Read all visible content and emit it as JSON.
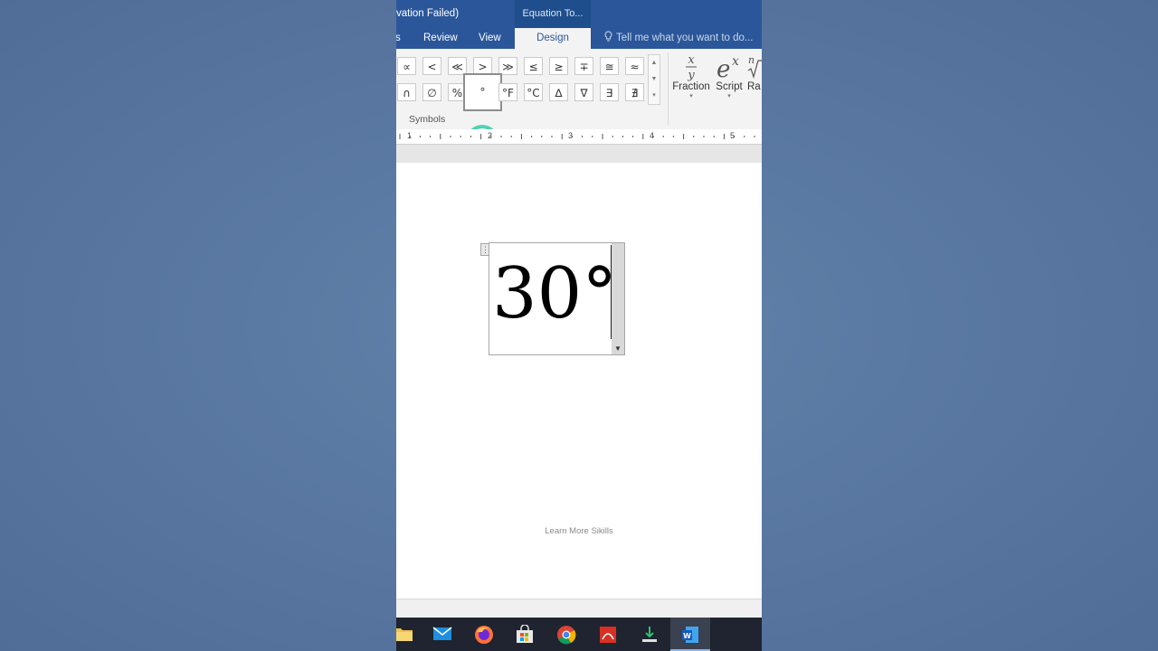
{
  "titlebar": {
    "title": "vation Failed)",
    "context_tab_label": "Equation To..."
  },
  "tabs": [
    {
      "label": "s",
      "active": false
    },
    {
      "label": "Review",
      "active": false
    },
    {
      "label": "View",
      "active": false
    },
    {
      "label": "Design",
      "active": true
    }
  ],
  "tell_me": {
    "placeholder": "Tell me what you want to do...",
    "icon": "lightbulb-icon"
  },
  "symbols_group": {
    "label": "Symbols",
    "row1": [
      "∝",
      "<",
      "≪",
      ">",
      "≫",
      "≤",
      "≥",
      "∓",
      "≅",
      "≈"
    ],
    "row2": [
      "∩",
      "∅",
      "%",
      "°",
      "°F",
      "°C",
      "∆",
      "∇",
      "∃",
      "∄"
    ],
    "selected_symbol": "°"
  },
  "structures": [
    {
      "label": "Fraction",
      "icon": "fraction-icon"
    },
    {
      "label": "Script",
      "icon": "script-icon"
    },
    {
      "label": "Ra",
      "icon": "radical-icon"
    }
  ],
  "ruler": {
    "numbers": [
      "1",
      "2",
      "3",
      "4",
      "5"
    ]
  },
  "equation": {
    "text": "30°"
  },
  "watermark": "Learn More Sikills",
  "taskbar": {
    "items": [
      {
        "name": "file-explorer",
        "active": false
      },
      {
        "name": "mail",
        "active": false
      },
      {
        "name": "firefox",
        "active": false
      },
      {
        "name": "store",
        "active": false
      },
      {
        "name": "chrome",
        "active": false
      },
      {
        "name": "pdf-app",
        "active": false
      },
      {
        "name": "installer",
        "active": false
      },
      {
        "name": "word",
        "active": true
      }
    ]
  },
  "colors": {
    "word_blue": "#2b579a",
    "highlight_ring": "#4ed3b4",
    "desktop_bg": "#5a7aa0"
  }
}
